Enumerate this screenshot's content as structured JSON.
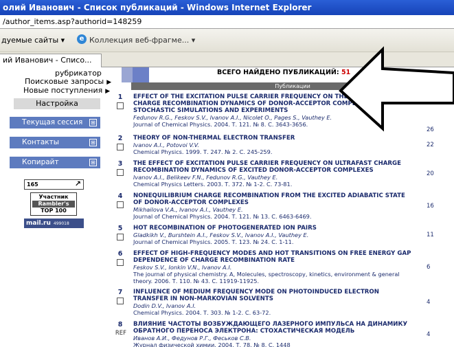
{
  "window": {
    "title": "олий Иванович - Список публикаций - Windows Internet Explorer",
    "address": "/author_items.asp?authorid=148259"
  },
  "favbar": {
    "suggested_sites": "дуемые сайты",
    "dropdown_glyph": "▾",
    "ie_icon": "ie-icon",
    "gallery": "Коллекция веб-фрагме..."
  },
  "tab": {
    "label": "ий Иванович - Списо..."
  },
  "nav": {
    "rubricator": "рубрикатор",
    "search_queries": "Поисковые запросы",
    "new_arrivals": "Новые поступления",
    "arrow_glyph": "▶",
    "settings": "Настройка",
    "current_session": "Текущая сессия",
    "contacts": "Контакты",
    "copyright": "Копирайт",
    "block_glyph": "⊞",
    "counter_label": "165",
    "counter_glyph": "↗",
    "rambler_top": "Участник",
    "rambler_mid": "Rambler's",
    "rambler_bottom": "TOP 100",
    "mailru": "mail.ru",
    "mailru_num": "499018"
  },
  "main": {
    "found_label": "ВСЕГО НАЙДЕНО ПУБЛИКАЦИЙ:",
    "found_count": "51",
    "publications_header": "Публикации",
    "publications": [
      {
        "index": "1",
        "title": "EFFECT OF THE EXCITATION PULSE CARRIER FREQUENCY ON THE ULTRAFAST CHARGE RECOMBINATION DYNAMICS OF DONOR-ACCEPTOR COMPLEXES: STOCHASTIC SIMULATIONS AND EXPERIMENTS",
        "authors": "Fedunov R.G., Feskov S.V., Ivanov A.I., Nicolet O., Pages S., Vauthey E.",
        "source": "Journal of Chemical Physics. 2004. Т. 121. № 8. С. 3643-3656.",
        "citations": "26"
      },
      {
        "index": "2",
        "title": "THEORY OF NON-THERMAL ELECTRON TRANSFER",
        "authors": "Ivanov A.I., Potovoi V.V.",
        "source": "Chemical Physics. 1999. Т. 247. № 2. С. 245-259.",
        "citations": "22"
      },
      {
        "index": "3",
        "title": "THE EFFECT OF EXCITATION PULSE CARRIER FREQUENCY ON ULTRAFAST CHARGE RECOMBINATION DYNAMICS OF EXCITED DONOR-ACCEPTOR COMPLEXES",
        "authors": "Ivanov A.I., Belikeev F.N., Fedunov R.G., Vauthey E.",
        "source": "Chemical Physics Letters. 2003. Т. 372. № 1-2. С. 73-81.",
        "citations": "20"
      },
      {
        "index": "4",
        "title": "NONEQUILIBRIUM CHARGE RECOMBINATION FROM THE EXCITED ADIABATIC STATE OF DONOR-ACCEPTOR COMPLEXES",
        "authors": "Mikhailova V.A., Ivanov A.I., Vauthey E.",
        "source": "Journal of Chemical Physics. 2004. Т. 121. № 13. С. 6463-6469.",
        "citations": "16"
      },
      {
        "index": "5",
        "title": "HOT RECOMBINATION OF PHOTOGENERATED ION PAIRS",
        "authors": "Gladkikh V., Burshtein A.I., Feskov S.V., Ivanov A.I., Vauthey E.",
        "source": "Journal of Chemical Physics. 2005. Т. 123. № 24. С. 1-11.",
        "citations": "11"
      },
      {
        "index": "6",
        "title": "EFFECT OF HIGH-FREQUENCY MODES AND HOT TRANSITIONS ON FREE ENERGY GAP DEPENDENCE OF CHARGE RECOMBINATION RATE",
        "authors": "Feskov S.V., Ionkin V.N., Ivanov A.I.",
        "source": "The journal of physical chemistry. A, Molecules, spectroscopy, kinetics, environment & general theory. 2006. Т. 110. № 43. С. 11919-11925.",
        "citations": "6"
      },
      {
        "index": "7",
        "title": "INFLUENCE OF MEDIUM FREQUENCY MODE ON PHOTOINDUCED ELECTRON TRANSFER IN NON-MARKOVIAN SOLVENTS",
        "authors": "Dodin D.V., Ivanov A.I.",
        "source": "Chemical Physics. 2004. Т. 303. № 1-2. С. 63-72.",
        "citations": "4"
      },
      {
        "index": "8",
        "ref": "REF",
        "title": "ВЛИЯНИЕ ЧАСТОТЫ ВОЗБУЖДАЮЩЕГО ЛАЗЕРНОГО ИМПУЛЬСА НА ДИНАМИКУ ОБРАТНОГО ПЕРЕНОСА ЭЛЕКТРОНА: СТОХАСТИЧЕСКАЯ МОДЕЛЬ",
        "authors": "Иванов А.И., Федунов Р.Г., Феськов С.В.",
        "source": "Журнал физической химии. 2004. Т. 78. № 8. С. 1448",
        "citations": "4"
      }
    ]
  },
  "overlay": {
    "arrow_color": "#000000",
    "arrow_fill": "#ffffff"
  }
}
